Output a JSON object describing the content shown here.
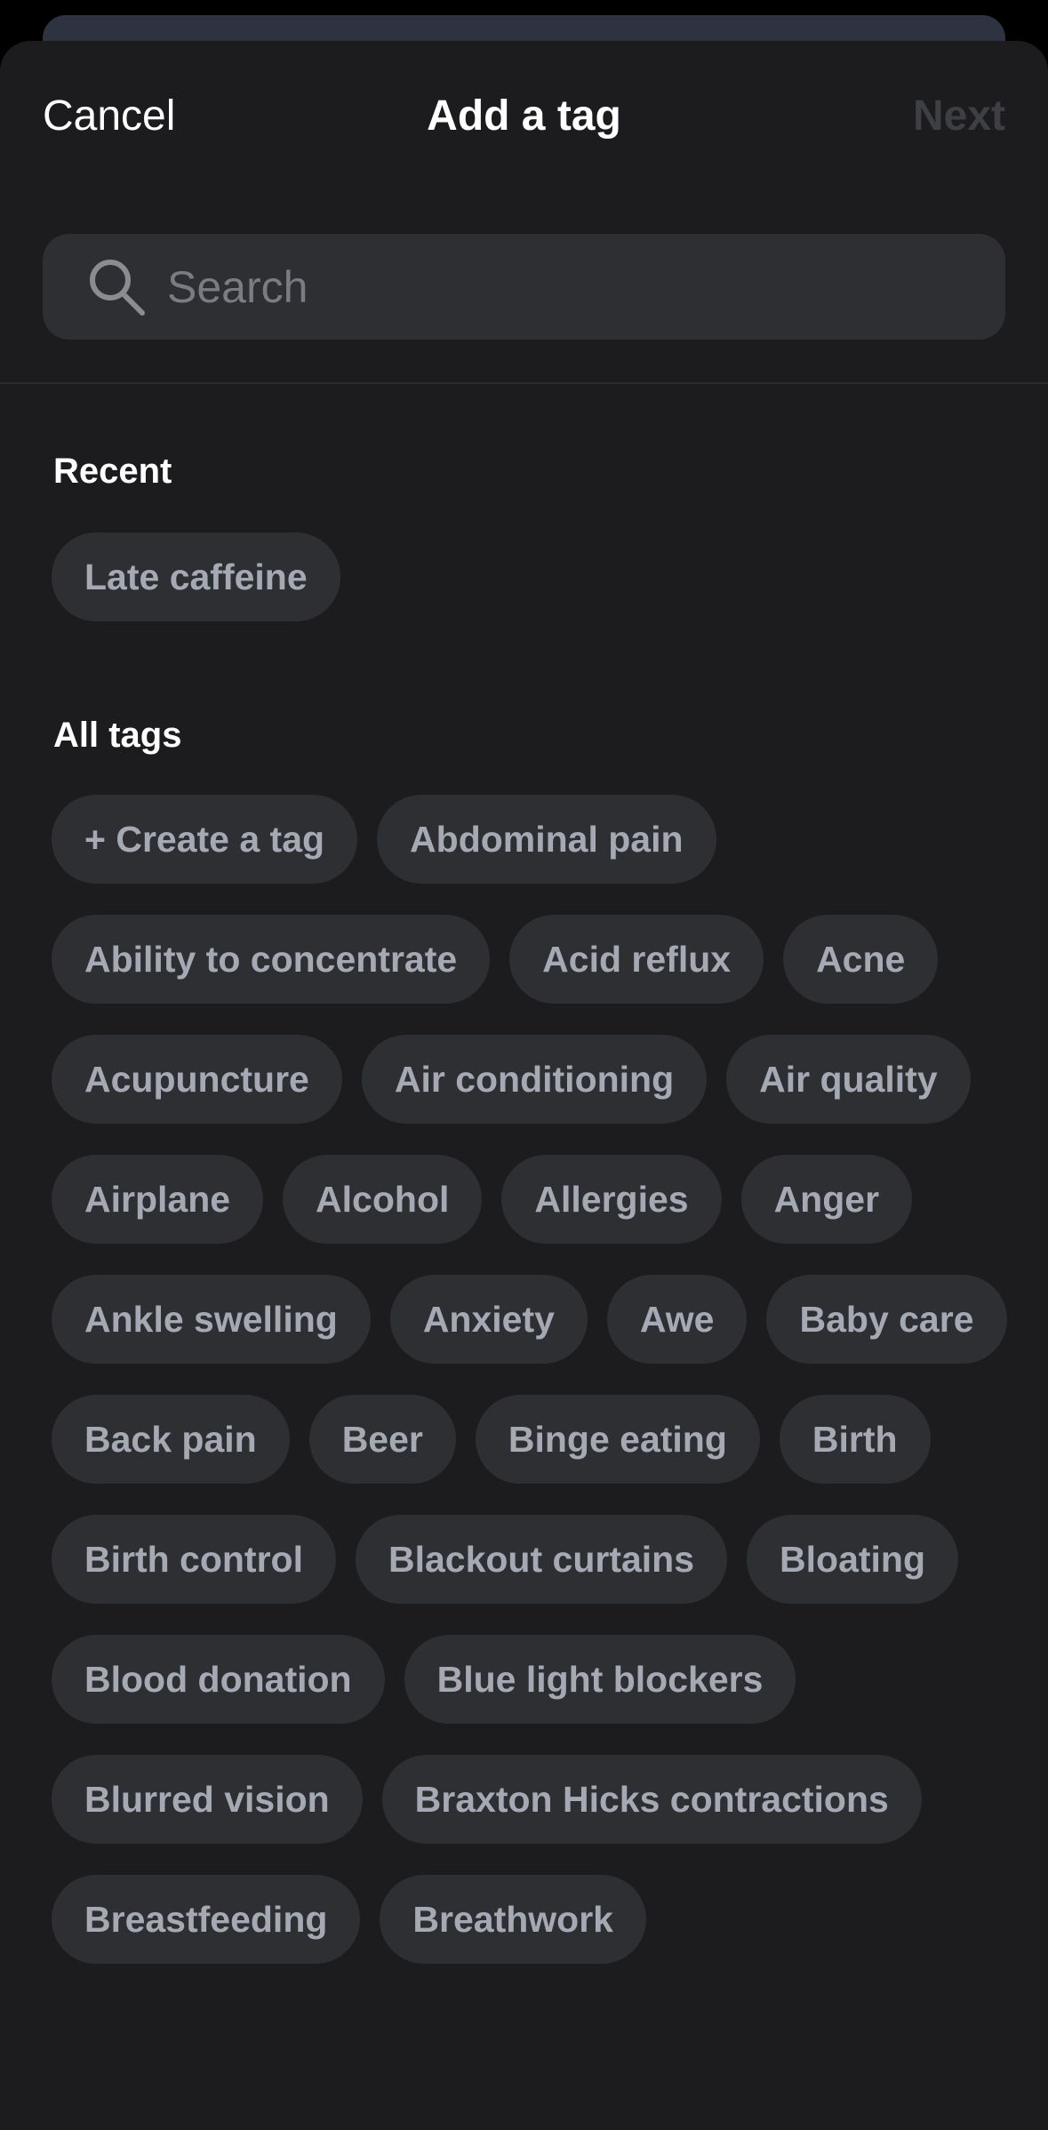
{
  "nav": {
    "cancel_label": "Cancel",
    "title": "Add a tag",
    "next_label": "Next"
  },
  "search": {
    "placeholder": "Search",
    "icon": "search-icon"
  },
  "sections": {
    "recent_title": "Recent",
    "all_title": "All tags"
  },
  "recent_tags": [
    "Late caffeine"
  ],
  "all_tags": [
    "+ Create a tag",
    "Abdominal pain",
    "Ability to concentrate",
    "Acid reflux",
    "Acne",
    "Acupuncture",
    "Air conditioning",
    "Air quality",
    "Airplane",
    "Alcohol",
    "Allergies",
    "Anger",
    "Ankle swelling",
    "Anxiety",
    "Awe",
    "Baby care",
    "Back pain",
    "Beer",
    "Binge eating",
    "Birth",
    "Birth control",
    "Blackout curtains",
    "Bloating",
    "Blood donation",
    "Blue light blockers",
    "Blurred vision",
    "Braxton Hicks contractions",
    "Breastfeeding",
    "Breathwork"
  ],
  "colors": {
    "background": "#1c1c1e",
    "chip_background": "#2e2f33",
    "chip_text": "#a5a9b3",
    "disabled_text": "#3e3f44",
    "placeholder_text": "#7b7c82"
  }
}
